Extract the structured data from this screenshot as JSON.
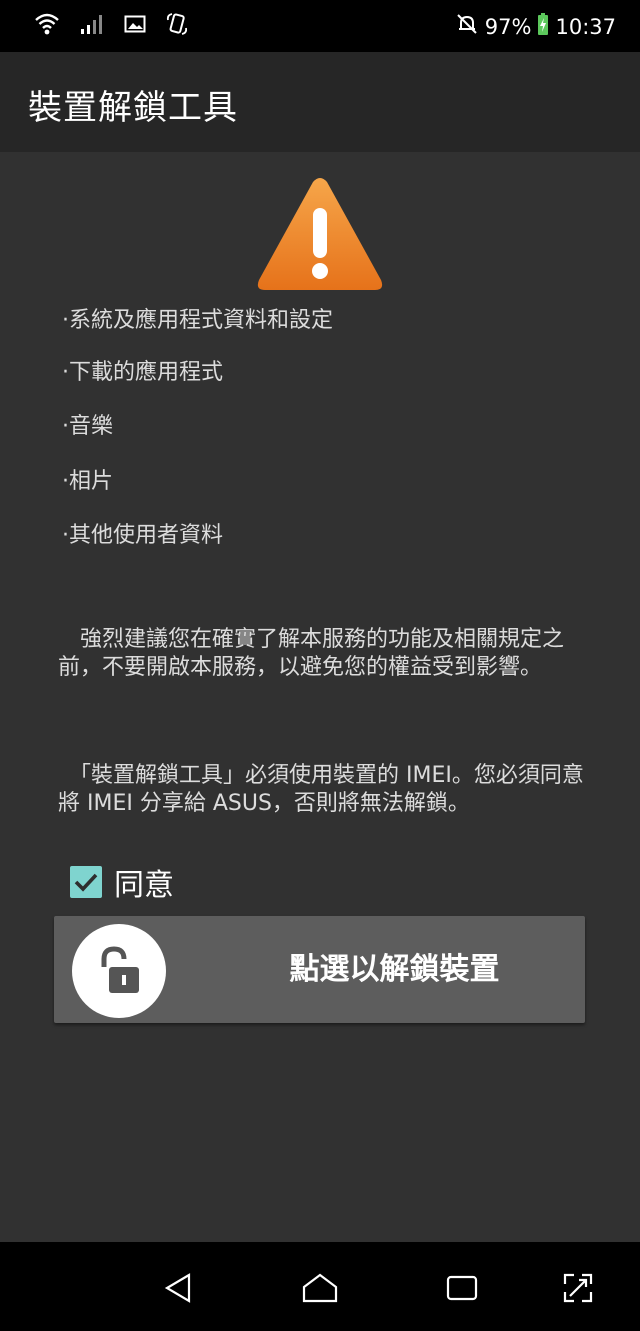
{
  "status_bar": {
    "battery": "97%",
    "time": "10:37",
    "icons_left": [
      "wifi-icon",
      "signal-icon",
      "image-icon",
      "screen-rotate-icon"
    ],
    "icons_right": [
      "mute-icon",
      "battery-charging-icon"
    ]
  },
  "app_bar": {
    "title": "裝置解鎖工具"
  },
  "warning_icon": "warning-icon",
  "bullets": [
    "·系統及應用程式資料和設定",
    "·下載的應用程式",
    "·音樂",
    "·相片",
    "·其他使用者資料"
  ],
  "paragraph1": "　強烈建議您在確實了解本服務的功能及相關規定之前，不要開啟本服務，以避免您的權益受到影響。",
  "paragraph2": "　「裝置解鎖工具」必須使用裝置的 IMEI。您必須同意將 IMEI 分享給 ASUS，否則將無法解鎖。",
  "agree": {
    "label": "同意",
    "checked": true
  },
  "unlock_button": {
    "label": "點選以解鎖裝置",
    "icon": "unlock-icon"
  },
  "nav_bar": {
    "buttons": [
      "back-icon",
      "home-icon",
      "recents-icon",
      "screenshot-expand-icon"
    ]
  },
  "colors": {
    "background": "#313131",
    "app_bar": "#262626",
    "button": "#5d5d5d",
    "checkbox": "#7fd4cf",
    "warning": "#f08a2a"
  }
}
